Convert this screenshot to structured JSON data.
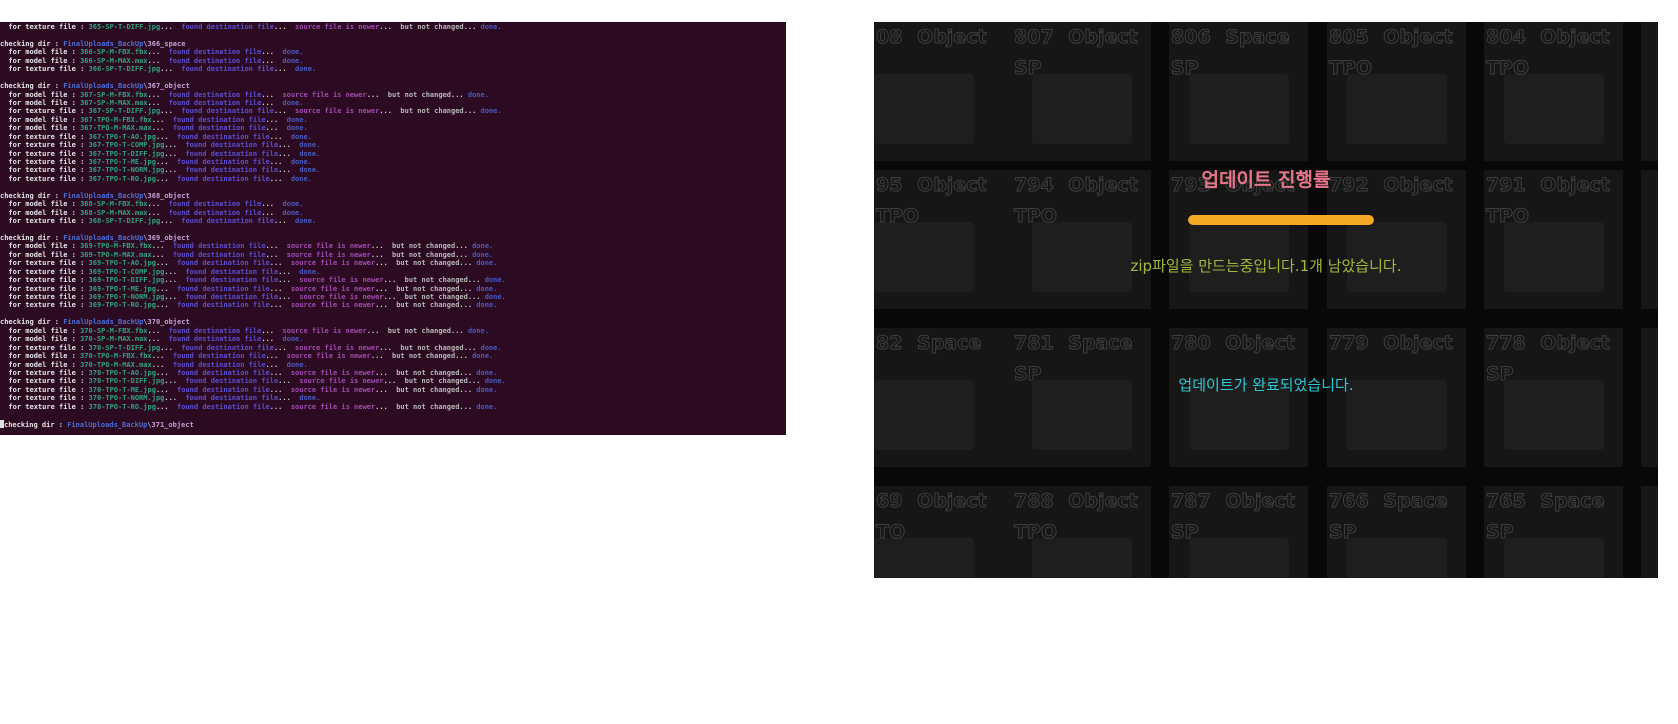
{
  "terminal": {
    "lines": [
      {
        "t": "file",
        "label": "  for texture file : ",
        "name": "365-SP-T-DIFF.jpg",
        "found": "found destination file",
        "source": "source file is newer",
        "nc": "but not changed",
        "done": "done."
      },
      {
        "t": "blank"
      },
      {
        "t": "dir",
        "label": "checking dir : ",
        "path": "FinalUploads_BackUp",
        "sub": "\\366_space"
      },
      {
        "t": "file",
        "label": "  for model file : ",
        "name": "366-SP-M-FBX.fbx",
        "found": "found destination file",
        "done": "done."
      },
      {
        "t": "file",
        "label": "  for model file : ",
        "name": "366-SP-M-MAX.max",
        "found": "found destination file",
        "done": "done."
      },
      {
        "t": "file",
        "label": "  for texture file : ",
        "name": "366-SP-T-DIFF.jpg",
        "found": "found destination file",
        "done": "done."
      },
      {
        "t": "blank"
      },
      {
        "t": "dir",
        "label": "checking dir : ",
        "path": "FinalUploads_BackUp",
        "sub": "\\367_object"
      },
      {
        "t": "file",
        "label": "  for model file : ",
        "name": "367-SP-M-FBX.fbx",
        "found": "found destination file",
        "source": "source file is newer",
        "nc": "but not changed",
        "done": "done."
      },
      {
        "t": "file",
        "label": "  for model file : ",
        "name": "367-SP-M-MAX.max",
        "found": "found destination file",
        "done": "done."
      },
      {
        "t": "file",
        "label": "  for texture file : ",
        "name": "367-SP-T-DIFF.jpg",
        "found": "found destination file",
        "source": "source file is newer",
        "nc": "but not changed",
        "done": "done."
      },
      {
        "t": "file",
        "label": "  for model file : ",
        "name": "367-TPO-M-FBX.fbx",
        "found": "found destination file",
        "done": "done."
      },
      {
        "t": "file",
        "label": "  for model file : ",
        "name": "367-TPO-M-MAX.max",
        "found": "found destination file",
        "done": "done."
      },
      {
        "t": "file",
        "label": "  for texture file : ",
        "name": "367-TPO-T-AO.jpg",
        "found": "found destination file",
        "done": "done."
      },
      {
        "t": "file",
        "label": "  for texture file : ",
        "name": "367-TPO-T-COMP.jpg",
        "found": "found destination file",
        "done": "done."
      },
      {
        "t": "file",
        "label": "  for texture file : ",
        "name": "367-TPO-T-DIFF.jpg",
        "found": "found destination file",
        "done": "done."
      },
      {
        "t": "file",
        "label": "  for texture file : ",
        "name": "367-TPO-T-ME.jpg",
        "found": "found destination file",
        "done": "done."
      },
      {
        "t": "file",
        "label": "  for texture file : ",
        "name": "367-TPO-T-NORM.jpg",
        "found": "found destination file",
        "done": "done."
      },
      {
        "t": "file",
        "label": "  for texture file : ",
        "name": "367-TPO-T-RO.jpg",
        "found": "found destination file",
        "done": "done."
      },
      {
        "t": "blank"
      },
      {
        "t": "dir",
        "label": "checking dir : ",
        "path": "FinalUploads_BackUp",
        "sub": "\\368_object"
      },
      {
        "t": "file",
        "label": "  for model file : ",
        "name": "368-SP-M-FBX.fbx",
        "found": "found destination file",
        "done": "done."
      },
      {
        "t": "file",
        "label": "  for model file : ",
        "name": "368-SP-M-MAX.max",
        "found": "found destination file",
        "done": "done."
      },
      {
        "t": "file",
        "label": "  for texture file : ",
        "name": "368-SP-T-DIFF.jpg",
        "found": "found destination file",
        "done": "done."
      },
      {
        "t": "blank"
      },
      {
        "t": "dir",
        "label": "checking dir : ",
        "path": "FinalUploads_BackUp",
        "sub": "\\369_object"
      },
      {
        "t": "file",
        "label": "  for model file : ",
        "name": "369-TPO-M-FBX.fbx",
        "found": "found destination file",
        "source": "source file is newer",
        "nc": "but not changed",
        "done": "done."
      },
      {
        "t": "file",
        "label": "  for model file : ",
        "name": "369-TPO-M-MAX.max",
        "found": "found destination file",
        "source": "source file is newer",
        "nc": "but not changed",
        "done": "done."
      },
      {
        "t": "file",
        "label": "  for texture file : ",
        "name": "369-TPO-T-AO.jpg",
        "found": "found destination file",
        "source": "source file is newer",
        "nc": "but not changed",
        "done": "done."
      },
      {
        "t": "file",
        "label": "  for texture file : ",
        "name": "369-TPO-T-COMP.jpg",
        "found": "found destination file",
        "done": "done."
      },
      {
        "t": "file",
        "label": "  for texture file : ",
        "name": "369-TPO-T-DIFF.jpg",
        "found": "found destination file",
        "source": "source file is newer",
        "nc": "but not changed",
        "done": "done."
      },
      {
        "t": "file",
        "label": "  for texture file : ",
        "name": "369-TPO-T-ME.jpg",
        "found": "found destination file",
        "source": "source file is newer",
        "nc": "but not changed",
        "done": "done."
      },
      {
        "t": "file",
        "label": "  for texture file : ",
        "name": "369-TPO-T-NORM.jpg",
        "found": "found destination file",
        "source": "source file is newer",
        "nc": "but not changed",
        "done": "done."
      },
      {
        "t": "file",
        "label": "  for texture file : ",
        "name": "369-TPO-T-RO.jpg",
        "found": "found destination file",
        "source": "source file is newer",
        "nc": "but not changed",
        "done": "done."
      },
      {
        "t": "blank"
      },
      {
        "t": "dir",
        "label": "checking dir : ",
        "path": "FinalUploads_BackUp",
        "sub": "\\370_object"
      },
      {
        "t": "file",
        "label": "  for model file : ",
        "name": "370-SP-M-FBX.fbx",
        "found": "found destination file",
        "source": "source file is newer",
        "nc": "but not changed",
        "done": "done."
      },
      {
        "t": "file",
        "label": "  for model file : ",
        "name": "370-SP-M-MAX.max",
        "found": "found destination file",
        "done": "done."
      },
      {
        "t": "file",
        "label": "  for texture file : ",
        "name": "370-SP-T-DIFF.jpg",
        "found": "found destination file",
        "source": "source file is newer",
        "nc": "but not changed",
        "done": "done."
      },
      {
        "t": "file",
        "label": "  for model file : ",
        "name": "370-TPO-M-FBX.fbx",
        "found": "found destination file",
        "source": "source file is newer",
        "nc": "but not changed",
        "done": "done."
      },
      {
        "t": "file",
        "label": "  for model file : ",
        "name": "370-TPO-M-MAX.max",
        "found": "found destination file",
        "done": "done."
      },
      {
        "t": "file",
        "label": "  for texture file : ",
        "name": "370-TPO-T-AO.jpg",
        "found": "found destination file",
        "source": "source file is newer",
        "nc": "but not changed",
        "done": "done."
      },
      {
        "t": "file",
        "label": "  for texture file : ",
        "name": "370-TPO-T-DIFF.jpg",
        "found": "found destination file",
        "source": "source file is newer",
        "nc": "but not changed",
        "done": "done."
      },
      {
        "t": "file",
        "label": "  for texture file : ",
        "name": "370-TPO-T-ME.jpg",
        "found": "found destination file",
        "source": "source file is newer",
        "nc": "but not changed",
        "done": "done."
      },
      {
        "t": "file",
        "label": "  for texture file : ",
        "name": "370-TPO-T-NORM.jpg",
        "found": "found destination file",
        "done": "done."
      },
      {
        "t": "file",
        "label": "  for texture file : ",
        "name": "370-TPO-T-RO.jpg",
        "found": "found destination file",
        "source": "source file is newer",
        "nc": "but not changed",
        "done": "done."
      },
      {
        "t": "blank"
      },
      {
        "t": "dir",
        "label": "checking dir : ",
        "path": "FinalUploads_BackUp",
        "sub": "\\371_object"
      }
    ]
  },
  "gallery": {
    "tiles": [
      "08 Object",
      "807 Object SP",
      "806 Space SP",
      "805 Object TPO",
      "804 Object TPO",
      "95 Object TPO",
      "794 Object TPO",
      "793 Object",
      "792 Object",
      "791 Object TPO",
      "82 Space",
      "781 Space SP",
      "780 Object",
      "779 Object",
      "778 Object SP",
      "69 Object TO",
      "788 Object TPO",
      "787 Object SP",
      "766 Space SP",
      "765 Space SP"
    ]
  },
  "progress": {
    "title": "업데이트 진행률",
    "fraction": 1.0,
    "zip_status": "zip파일을 만드는중입니다.1개 남았습니다.",
    "done_message": "업데이트가 완료되었습니다."
  },
  "colors": {
    "terminal_bg": "#2c0a22",
    "progress_title": "#e8768a",
    "progress_bar": "#f4aa22",
    "zip_status": "#a4b93a",
    "done_message": "#2ec8d6"
  }
}
